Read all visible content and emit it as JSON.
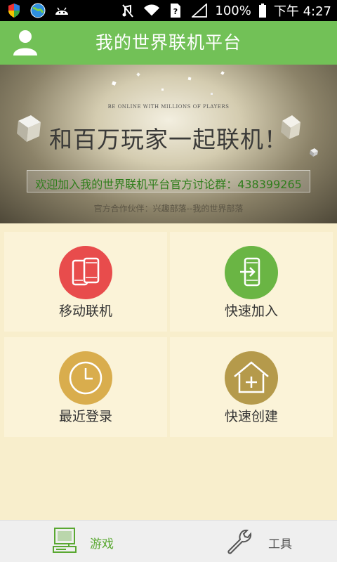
{
  "status_bar": {
    "battery": "100%",
    "time": "下午 4:27",
    "icons": [
      "shield-icon",
      "browser-icon",
      "android-icon",
      "mute-icon",
      "wifi-icon",
      "sim-icon",
      "signal-icon",
      "battery-icon"
    ]
  },
  "header": {
    "title": "我的世界联机平台",
    "avatar_icon": "user-icon",
    "color": "#72c157"
  },
  "banner": {
    "tagline": "BE ONLINE WITH MILLIONS OF PLAYERS",
    "headline": "和百万玩家一起联机！",
    "group": "欢迎加入我的世界联机平台官方讨论群：438399265",
    "partner": "官方合作伙伴：兴趣部落--我的世界部落"
  },
  "tiles": [
    {
      "label": "移动联机",
      "icon": "phones-icon",
      "color": "#e84c4c"
    },
    {
      "label": "快速加入",
      "icon": "phone-enter-icon",
      "color": "#6ab544"
    },
    {
      "label": "最近登录",
      "icon": "clock-icon",
      "color": "#d9ad4d"
    },
    {
      "label": "快速创建",
      "icon": "house-plus-icon",
      "color": "#b59a4b"
    }
  ],
  "bottom_nav": {
    "items": [
      {
        "label": "游戏",
        "icon": "computer-icon",
        "active": true
      },
      {
        "label": "工具",
        "icon": "wrench-icon",
        "active": false
      }
    ],
    "active_color": "#5aa832",
    "inactive_color": "#555555"
  }
}
